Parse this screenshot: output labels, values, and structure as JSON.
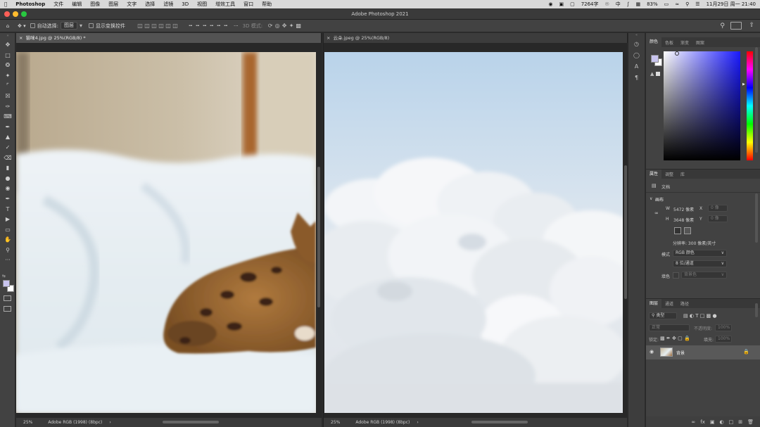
{
  "menubar": {
    "app": "Photoshop",
    "items": [
      "文件",
      "编辑",
      "图像",
      "图层",
      "文字",
      "选择",
      "滤镜",
      "3D",
      "视图",
      "增效工具",
      "窗口",
      "帮助"
    ],
    "status_chars": "7264字",
    "input_method": "中",
    "battery": "83%",
    "datetime": "11月29日 周一 21:40"
  },
  "window": {
    "title": "Adobe Photoshop 2021"
  },
  "options": {
    "auto_select_label": "自动选择:",
    "auto_select_value": "图层",
    "show_transform_label": "显示变换控件",
    "mode_3d_label": "3D 模式:"
  },
  "documents": [
    {
      "tab_label": "猫咪4.jpg @ 25%(RGB/8) *",
      "zoom": "25%",
      "profile": "Adobe RGB (1998) (8bpc)"
    },
    {
      "tab_label": "云朵.jpeg @ 25%(RGB/8)",
      "zoom": "25%",
      "profile": "Adobe RGB (1998) (8bpc)"
    }
  ],
  "color_panel": {
    "tabs": [
      "颜色",
      "色板",
      "渐变",
      "图案"
    ],
    "fg": "#c8c4ee",
    "bg": "#ffffff"
  },
  "properties_panel": {
    "tabs": [
      "属性",
      "调整",
      "库"
    ],
    "doc_label": "文档",
    "section_canvas": "画布",
    "w_label": "W",
    "w_value": "5472 像素",
    "h_label": "H",
    "h_value": "3648 像素",
    "x_label": "X",
    "x_placeholder": "0 像",
    "y_label": "Y",
    "y_placeholder": "0 像",
    "resolution": "分辨率: 300 像素/英寸",
    "mode_label": "模式",
    "mode_value": "RGB 颜色",
    "depth_value": "8 位/通道",
    "fill_label": "填色",
    "fill_value": "背景色"
  },
  "layers_panel": {
    "tabs": [
      "图层",
      "通道",
      "路径"
    ],
    "filter_label": "类型",
    "blend_mode": "正常",
    "opacity_label": "不透明度:",
    "opacity_value": "100%",
    "lock_label": "锁定:",
    "fill_label": "填充:",
    "fill_value": "100%",
    "layer_name": "背景"
  }
}
